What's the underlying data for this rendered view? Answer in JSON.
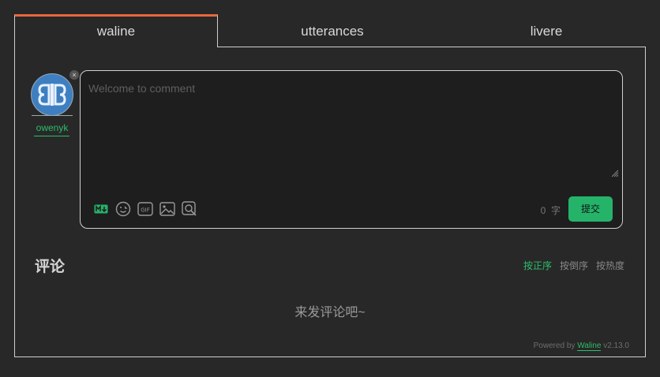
{
  "tabs": [
    "waline",
    "utterances",
    "livere"
  ],
  "user": {
    "nick": "owenyk",
    "logout_symbol": "×"
  },
  "editor": {
    "placeholder": "Welcome to comment",
    "word_count": "0",
    "word_unit": "字",
    "submit_label": "提交"
  },
  "toolbar_icons": [
    "markdown-icon",
    "emoji-icon",
    "gif-icon",
    "image-icon",
    "preview-icon"
  ],
  "comments": {
    "title": "评论",
    "sort_options": [
      "按正序",
      "按倒序",
      "按热度"
    ],
    "active_sort": "按正序",
    "empty_text": "来发评论吧~"
  },
  "footer": {
    "powered_prefix": "Powered by",
    "brand": "Waline",
    "version": "v2.13.0"
  },
  "colors": {
    "accent_green": "#25b36a",
    "tab_accent": "#e8683a",
    "background": "#282828"
  }
}
